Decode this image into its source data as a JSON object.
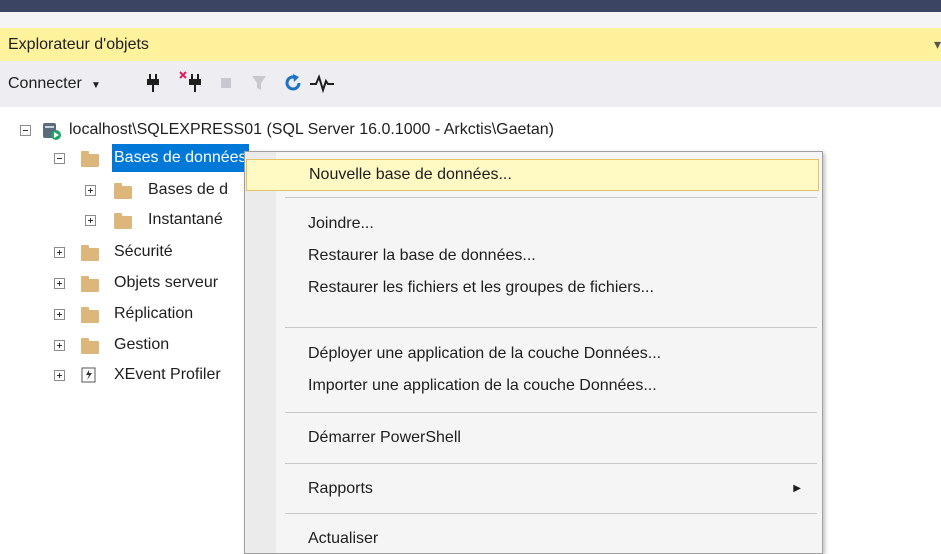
{
  "window": {
    "title": "Explorateur d'objets",
    "pin_glyph": "▾"
  },
  "toolbar": {
    "connect_label": "Connecter",
    "icons": [
      "connect-plug-icon",
      "disconnect-plug-icon",
      "stop-icon",
      "filter-icon",
      "refresh-icon",
      "activity-monitor-icon"
    ]
  },
  "tree": {
    "server": {
      "label": "localhost\\SQLEXPRESS01 (SQL Server 16.0.1000 - Arkctis\\Gaetan)"
    },
    "databases": {
      "label": "Bases de donn",
      "label_tail": "ées"
    },
    "system_databases": {
      "label": "Bases de d"
    },
    "snapshots": {
      "label": "Instantané"
    },
    "security": {
      "label": "Sécurité"
    },
    "server_objects": {
      "label": "Objets serveur"
    },
    "replication": {
      "label": "Réplication"
    },
    "management": {
      "label": "Gestion"
    },
    "xevent": {
      "label": "XEvent Profiler"
    }
  },
  "context_menu": {
    "items": [
      {
        "label": "Nouvelle base de données..."
      },
      {
        "label": "Joindre..."
      },
      {
        "label": "Restaurer la base de données..."
      },
      {
        "label": "Restaurer les fichiers et les groupes de fichiers..."
      },
      {
        "label": "Déployer une application de la couche Données..."
      },
      {
        "label": "Importer une application de la couche Données..."
      },
      {
        "label": "Démarrer PowerShell"
      },
      {
        "label": "Rapports"
      },
      {
        "label": "Actualiser"
      }
    ]
  },
  "colors": {
    "accent": "#0078d7",
    "title_bar": "#fff29d",
    "folder": "#dcb67a",
    "menu_highlight": "#fff9c4"
  }
}
